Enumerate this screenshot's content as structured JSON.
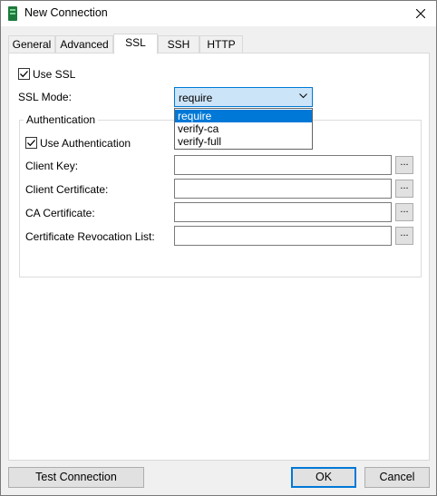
{
  "window": {
    "title": "New Connection",
    "accent": "#0078d7",
    "icon_color": "#1e7a3c"
  },
  "tabs": [
    {
      "label": "General",
      "active": false
    },
    {
      "label": "Advanced",
      "active": false
    },
    {
      "label": "SSL",
      "active": true
    },
    {
      "label": "SSH",
      "active": false
    },
    {
      "label": "HTTP",
      "active": false
    }
  ],
  "ssl": {
    "use_ssl_label": "Use SSL",
    "use_ssl_checked": true,
    "mode_label": "SSL Mode:",
    "mode_value": "require",
    "mode_options": [
      "require",
      "verify-ca",
      "verify-full"
    ],
    "mode_dropdown_open": true
  },
  "authentication": {
    "group_title": "Authentication",
    "use_auth_label": "Use Authentication",
    "use_auth_checked": true,
    "fields": [
      {
        "label": "Client Key:",
        "value": "",
        "browse": "..."
      },
      {
        "label": "Client Certificate:",
        "value": "",
        "browse": "..."
      },
      {
        "label": "CA Certificate:",
        "value": "",
        "browse": "..."
      },
      {
        "label": "Certificate Revocation List:",
        "value": "",
        "browse": "..."
      }
    ]
  },
  "footer": {
    "test_label": "Test Connection",
    "ok_label": "OK",
    "cancel_label": "Cancel"
  }
}
